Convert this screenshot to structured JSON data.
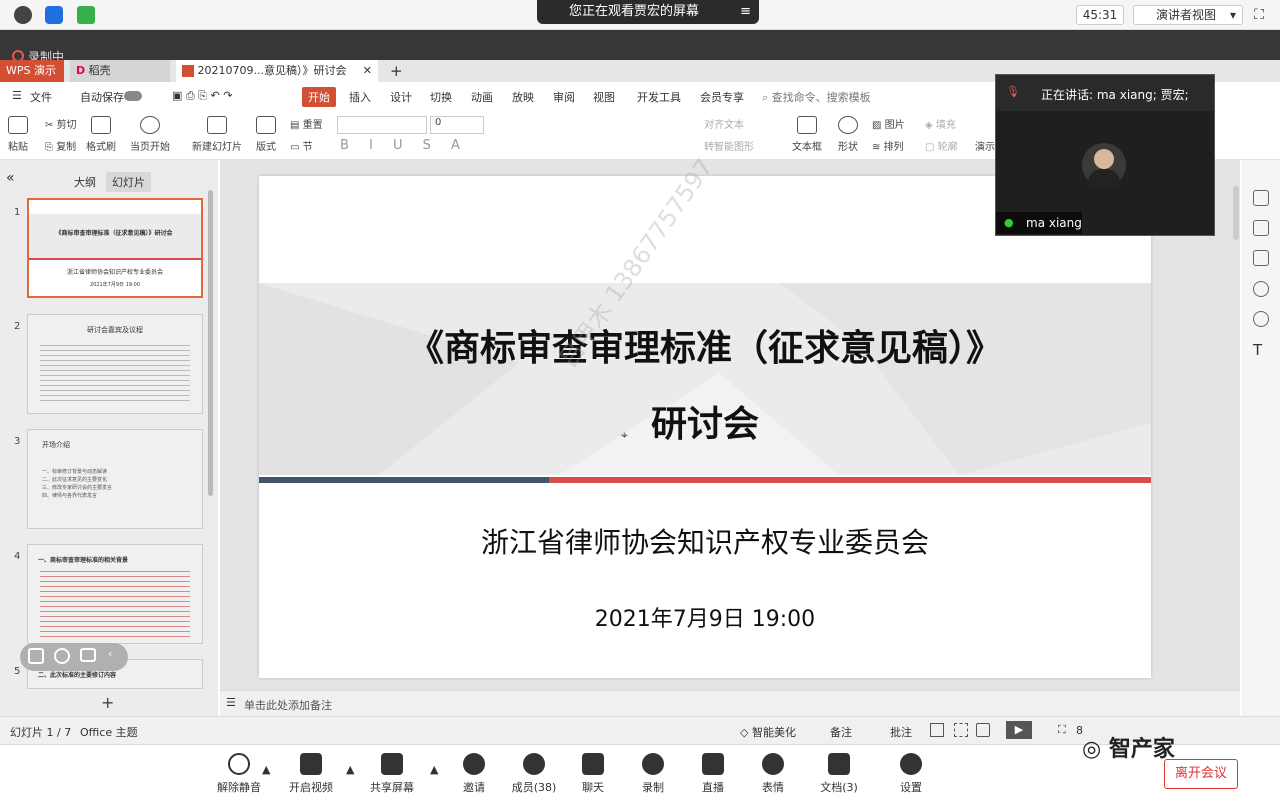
{
  "meeting": {
    "share_banner": "您正在观看贾宏的屏幕",
    "menu_icon": "≡",
    "timer": "45:31",
    "view_mode": "演讲者视图",
    "recording_label": "录制中",
    "speaking": "正在讲话: ma xiang; 贾宏;",
    "participant_name": "ma xiang",
    "leave_label": "离开会议",
    "toolbar": [
      {
        "label": "解除静音",
        "icon": "mic-muted-icon"
      },
      {
        "label": "开启视频",
        "icon": "video-off-icon"
      },
      {
        "label": "共享屏幕",
        "icon": "share-screen-icon"
      },
      {
        "label": "邀请",
        "icon": "invite-icon"
      },
      {
        "label": "成员(38)",
        "icon": "members-icon"
      },
      {
        "label": "聊天",
        "icon": "chat-icon"
      },
      {
        "label": "录制",
        "icon": "record-icon"
      },
      {
        "label": "直播",
        "icon": "live-icon"
      },
      {
        "label": "表情",
        "icon": "emoji-icon"
      },
      {
        "label": "文档(3)",
        "icon": "docs-icon"
      },
      {
        "label": "设置",
        "icon": "settings-icon"
      }
    ],
    "watermark_logo": "智产家"
  },
  "wps": {
    "app_tab": "WPS 演示",
    "tab2": "稻壳",
    "doc_tab": "20210709...意见稿）》研讨会",
    "menu": [
      "文件",
      "自动保存",
      "开始",
      "插入",
      "设计",
      "切换",
      "动画",
      "放映",
      "审阅",
      "视图",
      "开发工具",
      "会员专享"
    ],
    "search": "查找命令、搜索模板",
    "ribbon": [
      {
        "label": "粘贴"
      },
      {
        "label": "剪切"
      },
      {
        "label": "复制"
      },
      {
        "label": "格式刷"
      },
      {
        "label": "当页开始"
      },
      {
        "label": "新建幻灯片"
      },
      {
        "label": "版式"
      },
      {
        "label": "重置"
      },
      {
        "label": "节"
      },
      {
        "label": "对齐文本"
      },
      {
        "label": "转智能图形"
      },
      {
        "label": "文本框"
      },
      {
        "label": "形状"
      },
      {
        "label": "图片"
      },
      {
        "label": "排列"
      },
      {
        "label": "填充"
      },
      {
        "label": "轮廓"
      },
      {
        "label": "演示"
      }
    ],
    "font_size": "0",
    "panel_tabs": [
      "大纲",
      "幻灯片"
    ],
    "slides": [
      {
        "num": "1",
        "title": "《商标审查审理标准（征求意见稿）》研讨会",
        "sub": "浙江省律师协会知识产权专业委员会",
        "date": "2021年7月9日 19:00"
      },
      {
        "num": "2",
        "title": "研讨会嘉宾及议程"
      },
      {
        "num": "3",
        "title": "开场介绍",
        "items": [
          "一、标审修订背景与动态解读",
          "二、此次征求意见的主要变化",
          "三、修改专家研讨会的主要发言",
          "四、律师与各界代表发言"
        ]
      },
      {
        "num": "4",
        "title": "一、商标审查审理标准的相关背景"
      },
      {
        "num": "5",
        "title": "二、此次标准的主要修订内容"
      }
    ],
    "notes_placeholder": "单击此处添加备注",
    "status_slide": "幻灯片 1 / 7",
    "status_theme": "Office 主题",
    "status_beautify": "智能美化",
    "status_notes": "备注",
    "status_comment": "批注",
    "zoom": "8"
  },
  "slide": {
    "title_line1": "《商标审查审理标准（征求意见稿）》",
    "title_line2": "研讨会",
    "org": "浙江省律师协会知识产权专业委员会",
    "date": "2021年7月9日 19:00",
    "watermark": "吕甲木 13867757597",
    "colors": {
      "bar_left": "#44546a",
      "bar_right": "#d94c4c",
      "band": "#ebebeb"
    }
  }
}
